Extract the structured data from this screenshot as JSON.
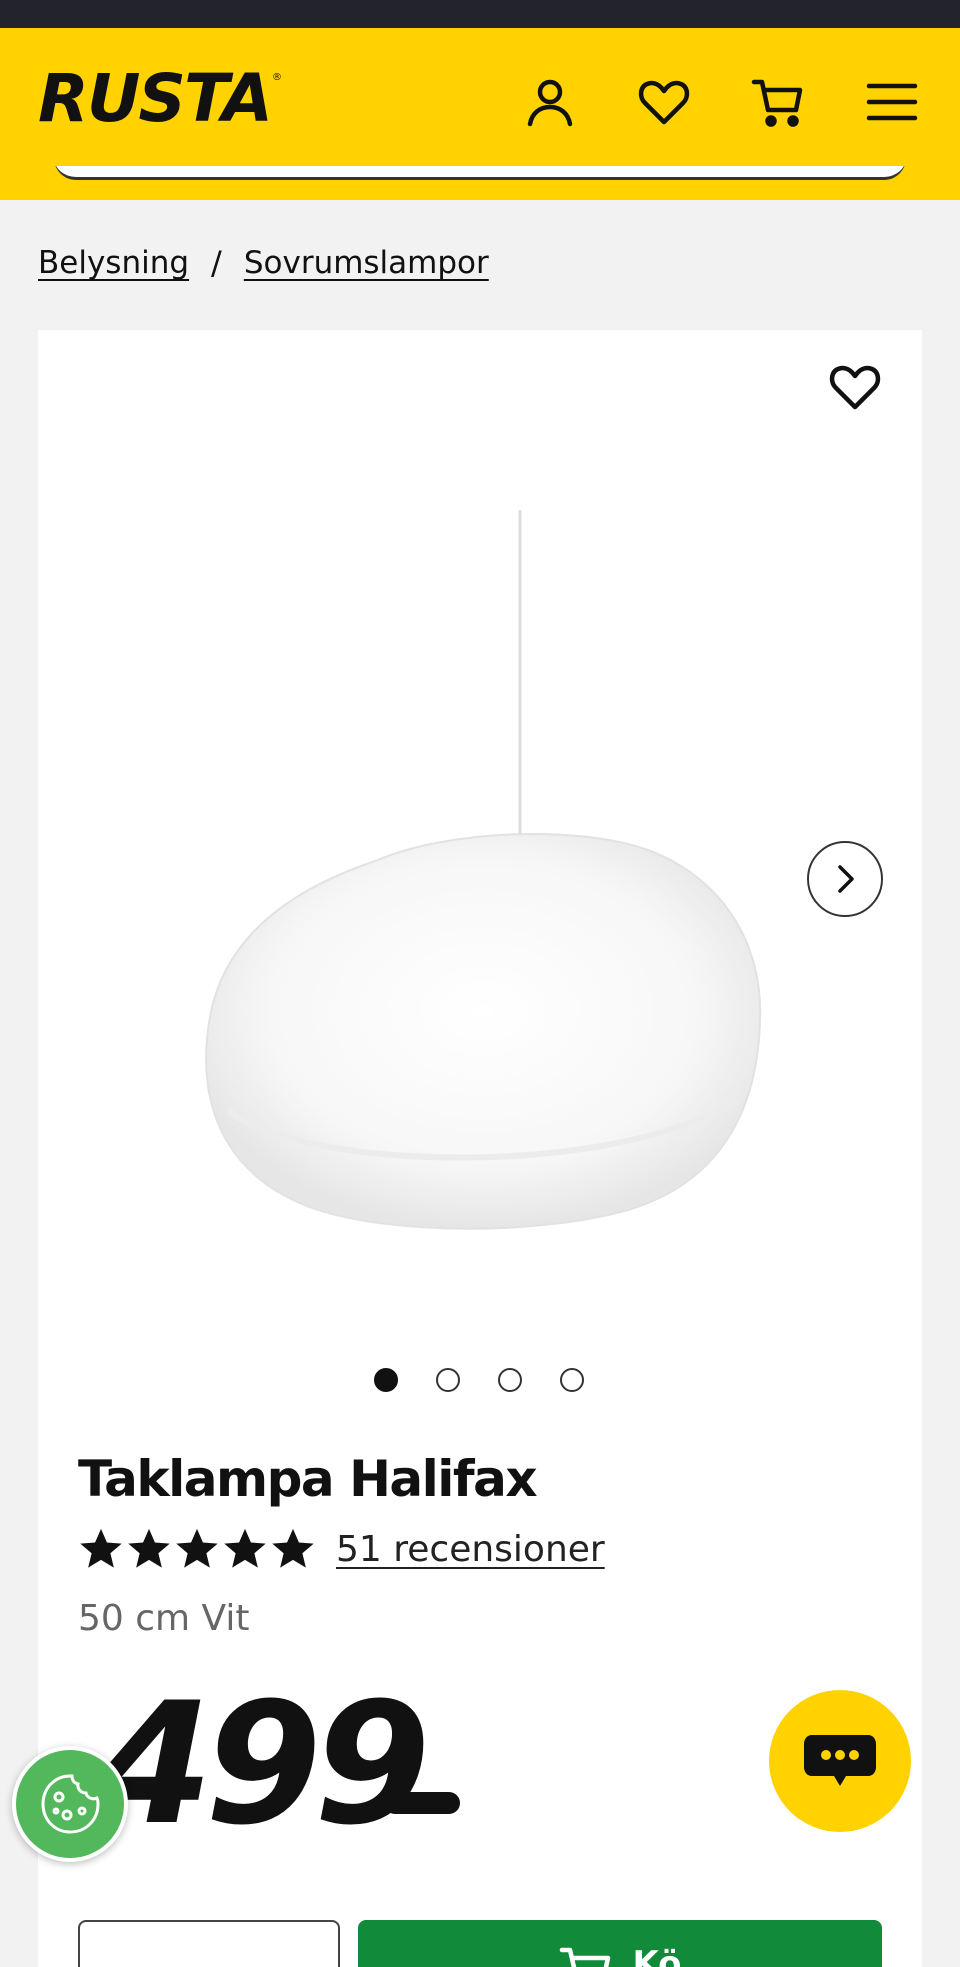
{
  "header": {
    "logo_text": "RUSTA",
    "logo_mark": "®",
    "brand_color": "#ffd200",
    "icons": [
      "account-icon",
      "heart-icon",
      "cart-icon",
      "menu-icon"
    ]
  },
  "breadcrumb": {
    "items": [
      {
        "label": "Belysning"
      },
      {
        "label": "Sovrumslampor"
      }
    ],
    "separator": "/"
  },
  "product": {
    "title": "Taklampa Halifax",
    "rating": 5,
    "rating_max": 5,
    "reviews_label": "51 recensioner",
    "variant": "50 cm Vit",
    "price": "499",
    "image_count": 4,
    "active_image": 1
  },
  "actions": {
    "buy_label": "Kö",
    "buy_color": "#118a3a"
  },
  "floating": {
    "chat_icon": "chat-bubble-icon",
    "cookie_icon": "cookie-icon"
  }
}
